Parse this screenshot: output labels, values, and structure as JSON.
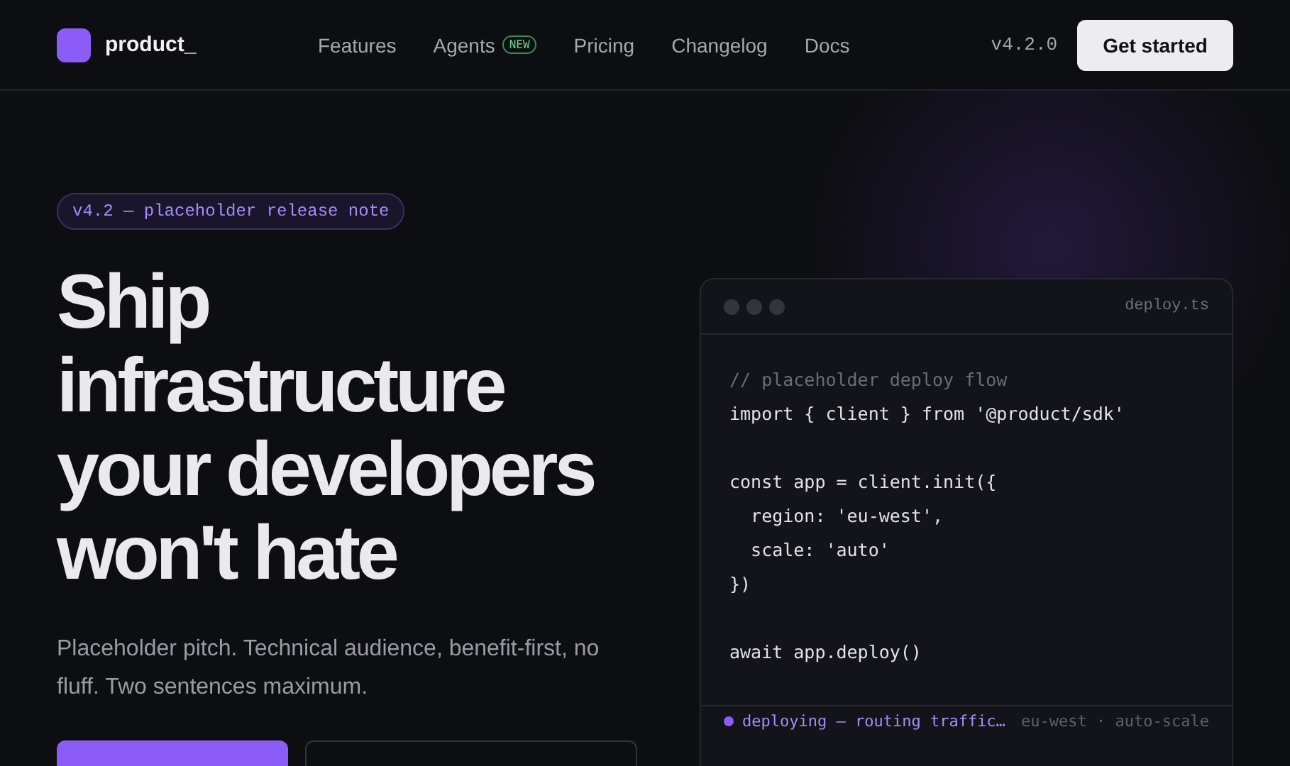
{
  "nav": {
    "brand": "product_",
    "links": [
      {
        "label": "Features"
      },
      {
        "label": "Agents",
        "badge": "NEW"
      },
      {
        "label": "Pricing"
      },
      {
        "label": "Changelog"
      },
      {
        "label": "Docs"
      }
    ],
    "version": "v4.2.0",
    "cta": "Get started"
  },
  "hero": {
    "release_note": "v4.2 — placeholder release note",
    "headline": "Ship infrastructure your developers won't hate",
    "pitch": "Placeholder pitch. Technical audience, benefit-first, no fluff. Two sentences maximum."
  },
  "code_window": {
    "filename": "deploy.ts",
    "lines": [
      {
        "kind": "comment",
        "text": "// placeholder deploy flow"
      },
      {
        "kind": "code",
        "text": "import { client } from '@product/sdk'"
      },
      {
        "kind": "blank"
      },
      {
        "kind": "code",
        "text": "const app = client.init({"
      },
      {
        "kind": "code",
        "text": "  region: 'eu-west',"
      },
      {
        "kind": "code",
        "text": "  scale: 'auto'"
      },
      {
        "kind": "code",
        "text": "})"
      },
      {
        "kind": "blank"
      },
      {
        "kind": "code",
        "text": "await app.deploy()"
      }
    ],
    "status": {
      "text": "deploying — routing traffic…",
      "meta": "eu-west · auto-scale"
    }
  }
}
